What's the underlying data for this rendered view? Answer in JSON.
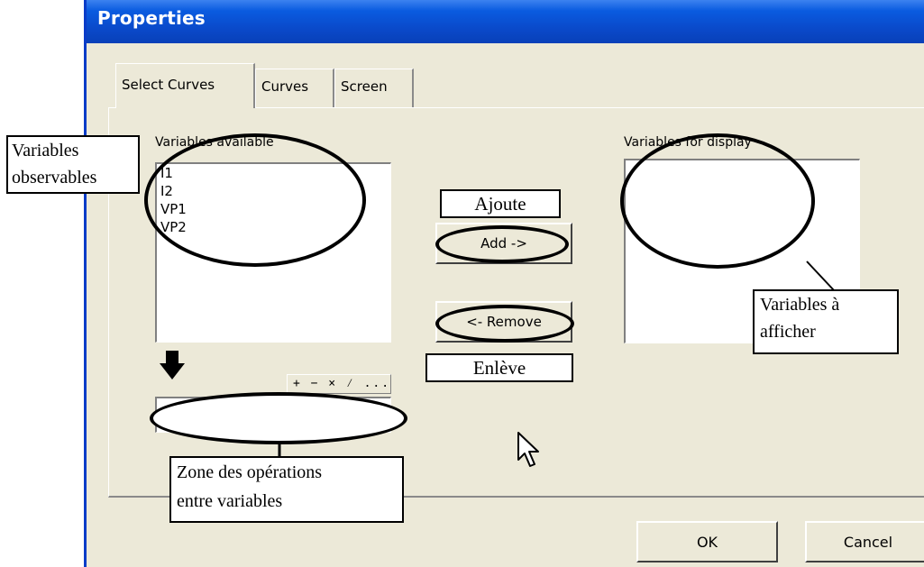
{
  "window": {
    "title": "Properties"
  },
  "tabs": [
    {
      "label": "Select Curves",
      "active": true
    },
    {
      "label": "Curves",
      "active": false
    },
    {
      "label": "Screen",
      "active": false
    }
  ],
  "available": {
    "label": "Variables available",
    "items": [
      "I1",
      "I2",
      "VP1",
      "VP2"
    ]
  },
  "display": {
    "label": "Variables for display"
  },
  "buttons": {
    "add": "Add ->",
    "remove": "<- Remove",
    "ok": "OK",
    "cancel": "Cancel"
  },
  "operators": "+ − × ⁄ ...",
  "annotations": {
    "observables_line1": "Variables",
    "observables_line2": "observables",
    "ajoute": "Ajoute",
    "enleve": "Enlève",
    "afficher_line1": "Variables à",
    "afficher_line2": "afficher",
    "zone_line1": "Zone des opérations",
    "zone_line2": "entre variables"
  },
  "colors": {
    "titlebar": "#0A48C8",
    "dialog_bg": "#ECE9D8",
    "annotation_border": "#000000"
  },
  "icons": [
    "down-arrow-icon",
    "mouse-pointer-icon"
  ]
}
